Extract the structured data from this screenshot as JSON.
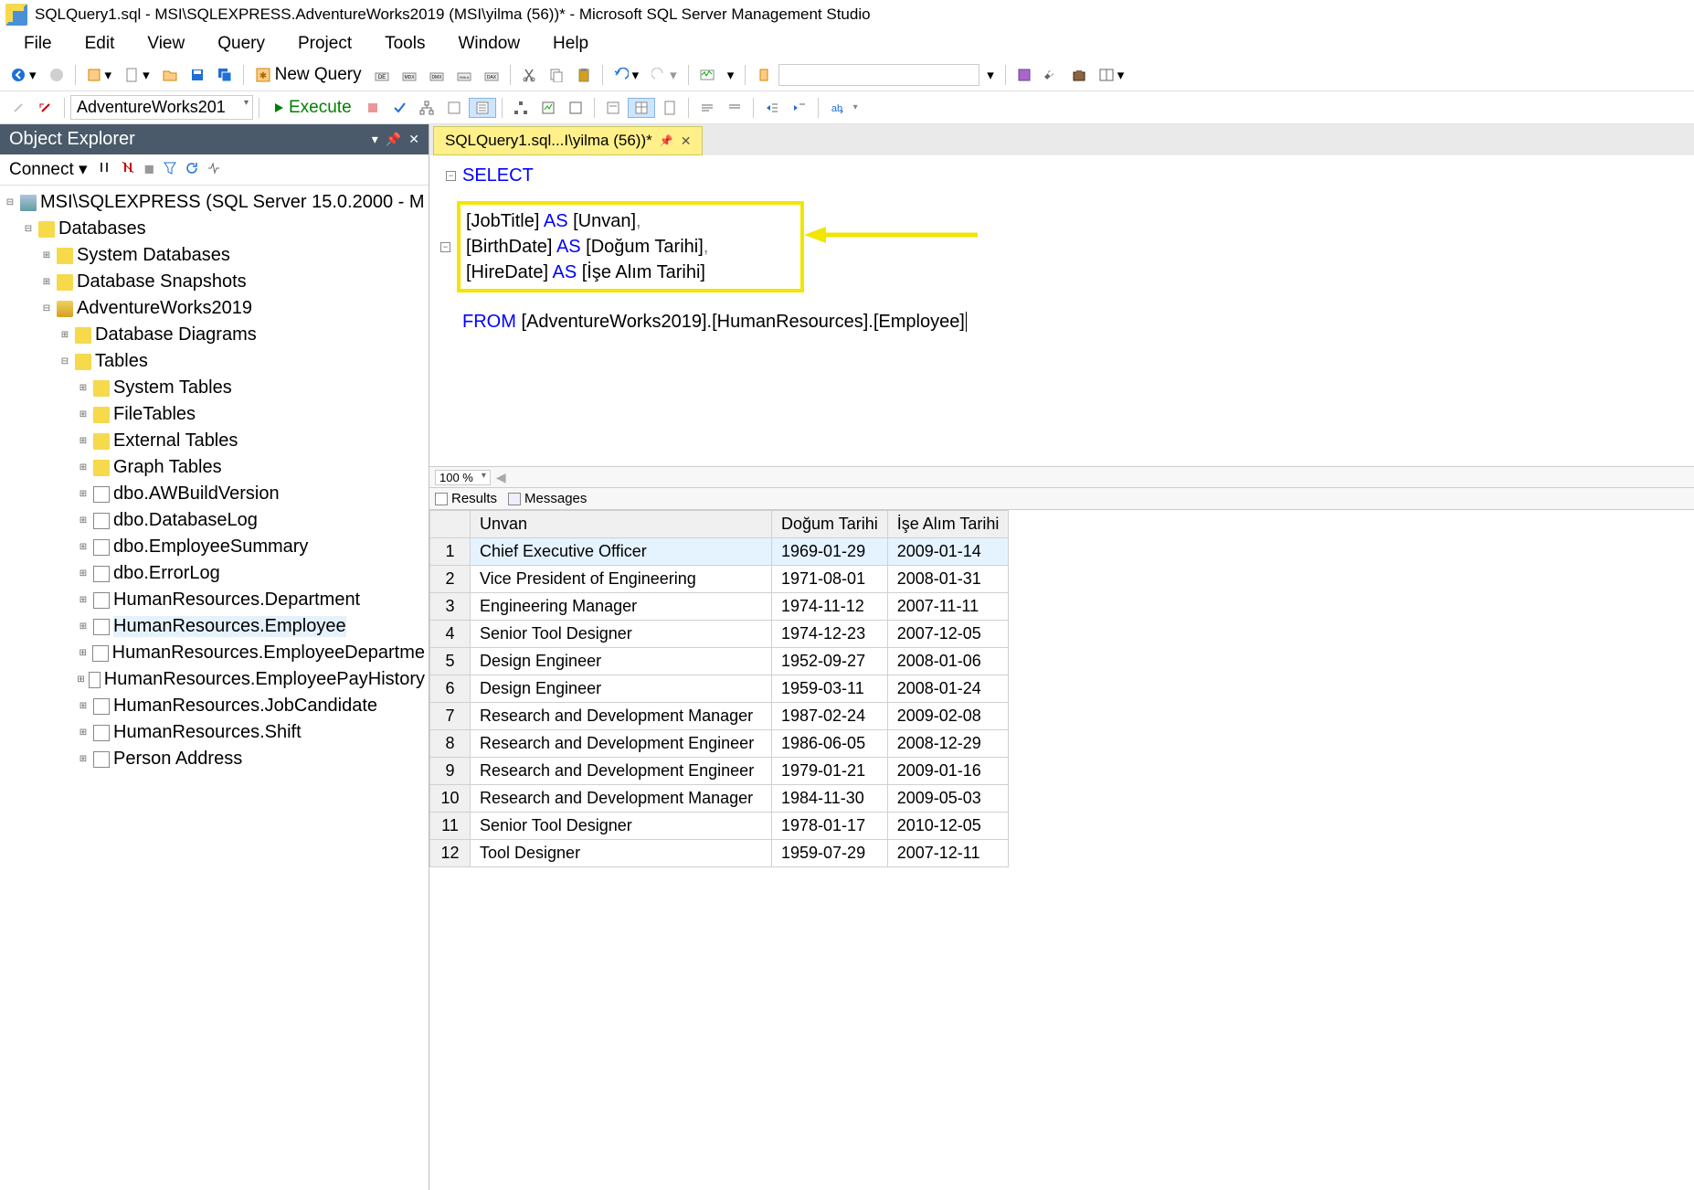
{
  "window": {
    "title": "SQLQuery1.sql - MSI\\SQLEXPRESS.AdventureWorks2019 (MSI\\yilma (56))* - Microsoft SQL Server Management Studio"
  },
  "menu": {
    "items": [
      "File",
      "Edit",
      "View",
      "Query",
      "Project",
      "Tools",
      "Window",
      "Help"
    ]
  },
  "toolbar1": {
    "new_query": "New Query"
  },
  "toolbar2": {
    "db_combo": "AdventureWorks201",
    "execute": "Execute"
  },
  "object_explorer": {
    "title": "Object Explorer",
    "connect": "Connect",
    "root": "MSI\\SQLEXPRESS (SQL Server 15.0.2000 - M",
    "nodes": [
      {
        "indent": 1,
        "exp": "-",
        "icon": "folder",
        "label": "Databases"
      },
      {
        "indent": 2,
        "exp": "+",
        "icon": "folder",
        "label": "System Databases"
      },
      {
        "indent": 2,
        "exp": "+",
        "icon": "folder",
        "label": "Database Snapshots"
      },
      {
        "indent": 2,
        "exp": "-",
        "icon": "db",
        "label": "AdventureWorks2019"
      },
      {
        "indent": 3,
        "exp": "+",
        "icon": "folder",
        "label": "Database Diagrams"
      },
      {
        "indent": 3,
        "exp": "-",
        "icon": "folder",
        "label": "Tables"
      },
      {
        "indent": 4,
        "exp": "+",
        "icon": "folder",
        "label": "System Tables"
      },
      {
        "indent": 4,
        "exp": "+",
        "icon": "folder",
        "label": "FileTables"
      },
      {
        "indent": 4,
        "exp": "+",
        "icon": "folder",
        "label": "External Tables"
      },
      {
        "indent": 4,
        "exp": "+",
        "icon": "folder",
        "label": "Graph Tables"
      },
      {
        "indent": 4,
        "exp": "+",
        "icon": "table",
        "label": "dbo.AWBuildVersion"
      },
      {
        "indent": 4,
        "exp": "+",
        "icon": "table",
        "label": "dbo.DatabaseLog"
      },
      {
        "indent": 4,
        "exp": "+",
        "icon": "table",
        "label": "dbo.EmployeeSummary"
      },
      {
        "indent": 4,
        "exp": "+",
        "icon": "table",
        "label": "dbo.ErrorLog"
      },
      {
        "indent": 4,
        "exp": "+",
        "icon": "table",
        "label": "HumanResources.Department"
      },
      {
        "indent": 4,
        "exp": "+",
        "icon": "table",
        "label": "HumanResources.Employee",
        "selected": true
      },
      {
        "indent": 4,
        "exp": "+",
        "icon": "table",
        "label": "HumanResources.EmployeeDepartme"
      },
      {
        "indent": 4,
        "exp": "+",
        "icon": "table",
        "label": "HumanResources.EmployeePayHistory"
      },
      {
        "indent": 4,
        "exp": "+",
        "icon": "table",
        "label": "HumanResources.JobCandidate"
      },
      {
        "indent": 4,
        "exp": "+",
        "icon": "table",
        "label": "HumanResources.Shift"
      },
      {
        "indent": 4,
        "exp": "+",
        "icon": "table",
        "label": "Person Address"
      }
    ]
  },
  "doc_tab": {
    "label": "SQLQuery1.sql...I\\yilma (56))*"
  },
  "editor": {
    "line1_kw": "SELECT",
    "line2_pre": "[JobTitle] ",
    "line2_as": "AS",
    "line2_post": " [Unvan]",
    "line2_comma": ",",
    "line3_pre": "[BirthDate] ",
    "line3_as": "AS",
    "line3_post": " [Doğum Tarihi]",
    "line3_comma": ",",
    "line4_pre": "[HireDate] ",
    "line4_as": "AS",
    "line4_post": " [İşe Alım Tarihi]",
    "line6_kw": "FROM",
    "line6_rest": " [AdventureWorks2019].[HumanResources].[Employee]"
  },
  "zoom": "100 %",
  "result_tabs": {
    "results": "Results",
    "messages": "Messages"
  },
  "grid": {
    "columns": [
      "",
      "Unvan",
      "Doğum Tarihi",
      "İşe Alım Tarihi"
    ],
    "rows": [
      [
        "1",
        "Chief Executive Officer",
        "1969-01-29",
        "2009-01-14"
      ],
      [
        "2",
        "Vice President of Engineering",
        "1971-08-01",
        "2008-01-31"
      ],
      [
        "3",
        "Engineering Manager",
        "1974-11-12",
        "2007-11-11"
      ],
      [
        "4",
        "Senior Tool Designer",
        "1974-12-23",
        "2007-12-05"
      ],
      [
        "5",
        "Design Engineer",
        "1952-09-27",
        "2008-01-06"
      ],
      [
        "6",
        "Design Engineer",
        "1959-03-11",
        "2008-01-24"
      ],
      [
        "7",
        "Research and Development Manager",
        "1987-02-24",
        "2009-02-08"
      ],
      [
        "8",
        "Research and Development Engineer",
        "1986-06-05",
        "2008-12-29"
      ],
      [
        "9",
        "Research and Development Engineer",
        "1979-01-21",
        "2009-01-16"
      ],
      [
        "10",
        "Research and Development Manager",
        "1984-11-30",
        "2009-05-03"
      ],
      [
        "11",
        "Senior Tool Designer",
        "1978-01-17",
        "2010-12-05"
      ],
      [
        "12",
        "Tool Designer",
        "1959-07-29",
        "2007-12-11"
      ]
    ]
  }
}
